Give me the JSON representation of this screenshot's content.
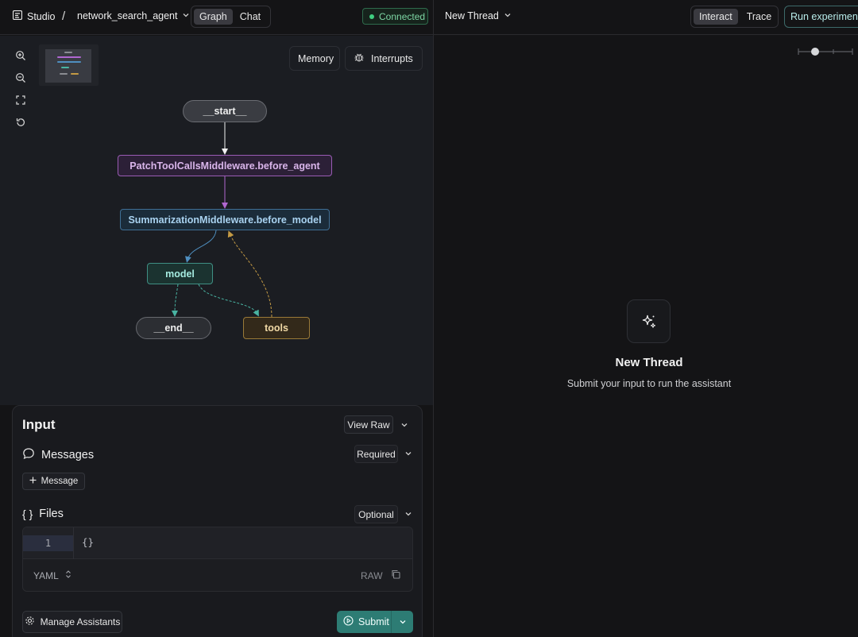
{
  "topbar": {
    "app_name": "Studio",
    "separator": "/",
    "agent_name": "network_search_agent",
    "view_tabs": [
      {
        "label": "Graph",
        "active": true
      },
      {
        "label": "Chat",
        "active": false
      }
    ],
    "status": "Connected",
    "status_color": "#3fcf80",
    "thread_name": "New Thread",
    "mode_tabs": [
      {
        "label": "Interact",
        "active": true
      },
      {
        "label": "Trace",
        "active": false
      }
    ],
    "run_experiment_label": "Run experiment"
  },
  "graph": {
    "toolbar": {
      "memory_label": "Memory",
      "interrupts_label": "Interrupts"
    },
    "nodes": {
      "start": "__start__",
      "patch": "PatchToolCallsMiddleware.before_agent",
      "summarization": "SummarizationMiddleware.before_model",
      "model": "model",
      "end": "__end__",
      "tools": "tools"
    },
    "colors": {
      "patch": "#9a5bb4",
      "summarization": "#3f6f95",
      "model": "#3f8f84",
      "tools": "#9a7a38"
    }
  },
  "input": {
    "title": "Input",
    "view_raw_label": "View Raw",
    "messages": {
      "label": "Messages",
      "requirement": "Required",
      "add_label": "Message"
    },
    "files": {
      "brace_label": "{ }",
      "label": "Files",
      "requirement": "Optional"
    },
    "editor": {
      "line_number": "1",
      "content": "{}",
      "format_label": "YAML",
      "raw_label": "RAW"
    },
    "manage_assistants_label": "Manage Assistants",
    "submit_label": "Submit"
  },
  "thread": {
    "title": "New Thread",
    "subtitle": "Submit your input to run the assistant"
  }
}
